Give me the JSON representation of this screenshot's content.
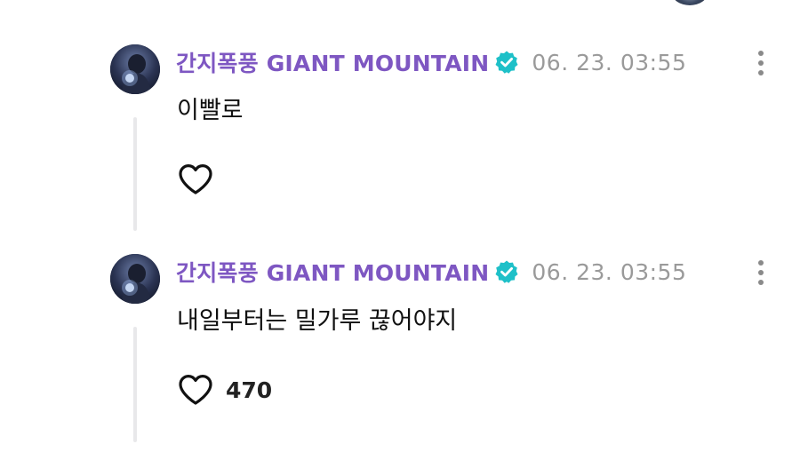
{
  "comments": [
    {
      "author": "간지폭풍 GIANT MOUNTAIN",
      "verified": true,
      "timestamp": "06. 23. 03:55",
      "text": "이빨로",
      "like_count": ""
    },
    {
      "author": "간지폭풍 GIANT MOUNTAIN",
      "verified": true,
      "timestamp": "06. 23. 03:55",
      "text": "내일부터는 밀가루 끊어야지",
      "like_count": "470"
    }
  ],
  "icons": {
    "verified": "verified-badge-icon",
    "like": "heart-outline-icon",
    "more": "vertical-ellipsis-icon"
  },
  "colors": {
    "author": "#7e57c2",
    "verified_badge": "#1ec0c8",
    "timestamp": "#9a9a9a",
    "thread_line": "#e8e8ea"
  }
}
